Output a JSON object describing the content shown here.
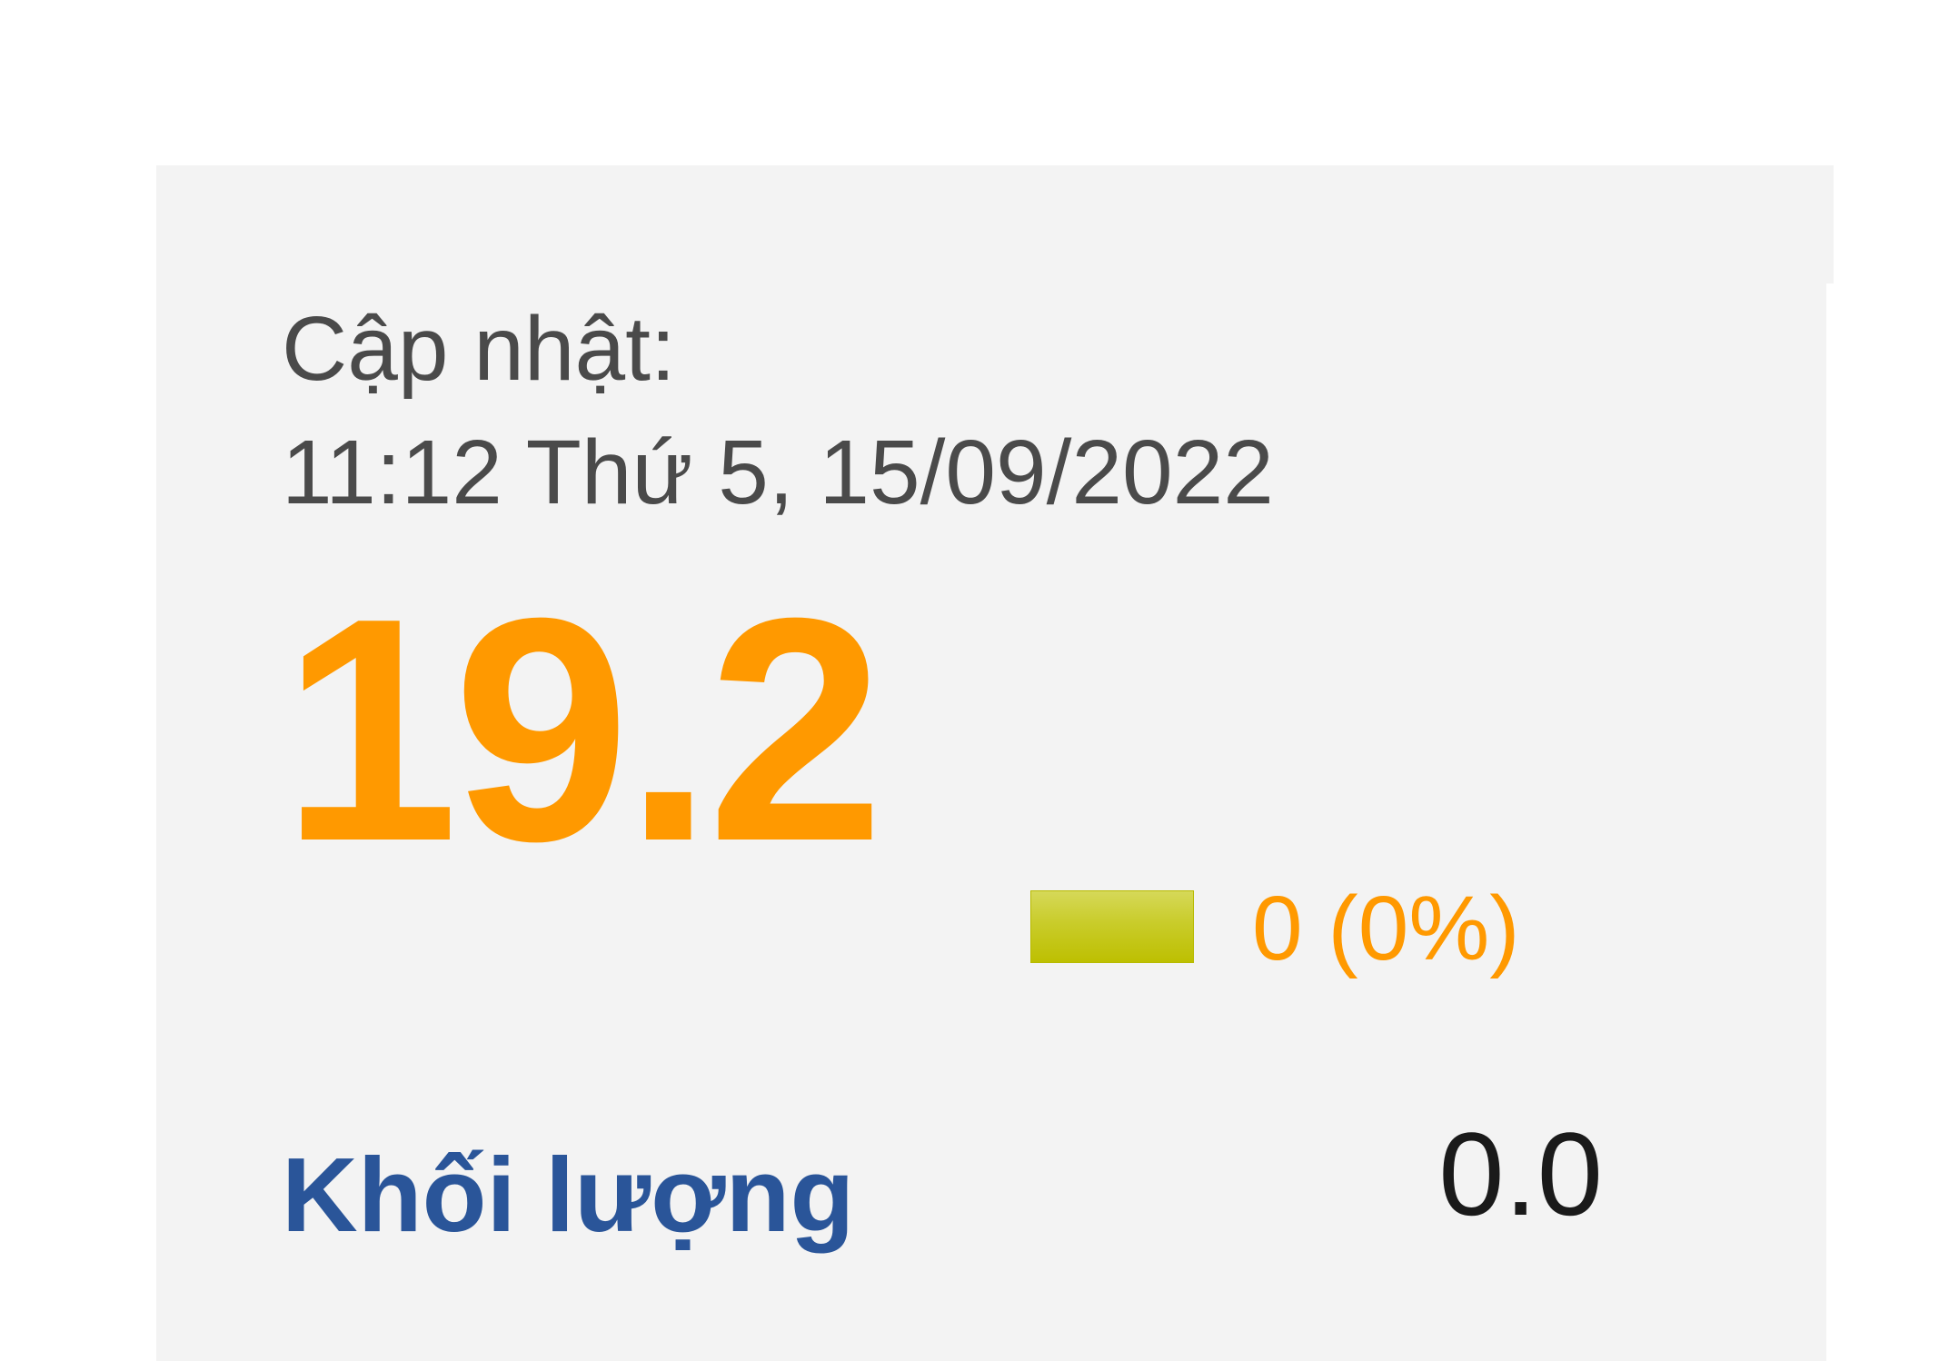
{
  "stock": {
    "update_label": "Cập nhật:",
    "update_time": "11:12 Thứ 5, 15/09/2022",
    "price": "19.2",
    "change_indicator_icon": "unchanged-bar-icon",
    "change_text": "0 (0%)",
    "volume_label": "Khối lượng",
    "volume_value": "0.0"
  },
  "colors": {
    "price": "#ff9900",
    "volume_label": "#2a5599",
    "indicator": "#c9cc2a",
    "panel_bg": "#f3f3f3"
  }
}
